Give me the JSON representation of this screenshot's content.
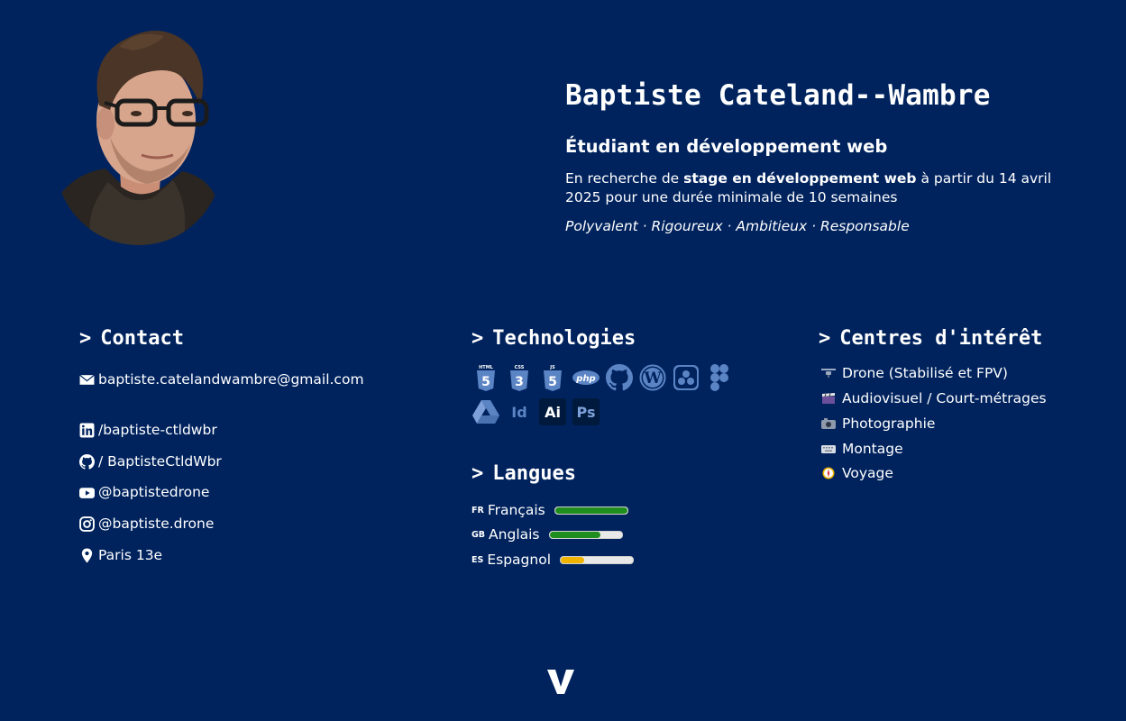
{
  "header": {
    "name": "Baptiste Cateland--Wambre",
    "role": "Étudiant en développement web",
    "seeking_pre": "En recherche de ",
    "seeking_bold": "stage en développement web",
    "seeking_post": " à partir du 14 avril 2025 pour une durée minimale de 10 semaines",
    "qualities": "Polyvalent · Rigoureux · Ambitieux · Responsable"
  },
  "contact": {
    "title": "Contact",
    "prompt": ">",
    "email": "baptiste.catelandwambre@gmail.com",
    "linkedin": "/baptiste-ctldwbr",
    "github": "/ BaptisteCtldWbr",
    "youtube": "@baptistedrone",
    "instagram": "@baptiste.drone",
    "location": "Paris 13e"
  },
  "technologies": {
    "title": "Technologies",
    "prompt": ">",
    "icons": [
      "html5-icon",
      "css3-icon",
      "js-icon",
      "php-icon",
      "github-icon",
      "wordpress-icon",
      "davinci-resolve-icon",
      "figma-icon",
      "google-drive-icon",
      "indesign-icon",
      "illustrator-icon",
      "photoshop-icon"
    ],
    "html_label": "HTML",
    "css_label": "CSS",
    "js_label": "JS",
    "php_label": "php",
    "indesign_label": "Id",
    "illustrator_label": "Ai",
    "photoshop_label": "Ps"
  },
  "languages": {
    "title": "Langues",
    "prompt": ">",
    "items": [
      {
        "code": "FR",
        "name": "Français",
        "level": 1.0,
        "color": "#1e8e1e"
      },
      {
        "code": "GB",
        "name": "Anglais",
        "level": 0.7,
        "color": "#1e8e1e"
      },
      {
        "code": "ES",
        "name": "Espagnol",
        "level": 0.33,
        "color": "#f0b400"
      }
    ]
  },
  "interests": {
    "title": "Centres d'intérêt",
    "prompt": ">",
    "items": [
      {
        "label": "Drone (Stabilisé et FPV)",
        "icon": "drone-icon"
      },
      {
        "label": "Audiovisuel / Court-métrages",
        "icon": "clapperboard-icon"
      },
      {
        "label": "Photographie",
        "icon": "camera-icon"
      },
      {
        "label": "Montage",
        "icon": "keyboard-icon"
      },
      {
        "label": "Voyage",
        "icon": "compass-icon"
      }
    ]
  },
  "colors": {
    "background": "#00235e",
    "text": "#ffffff",
    "icon_blue": "#5b84c4",
    "fluent": "#1e8e1e",
    "intermediate": "#f0b400"
  }
}
